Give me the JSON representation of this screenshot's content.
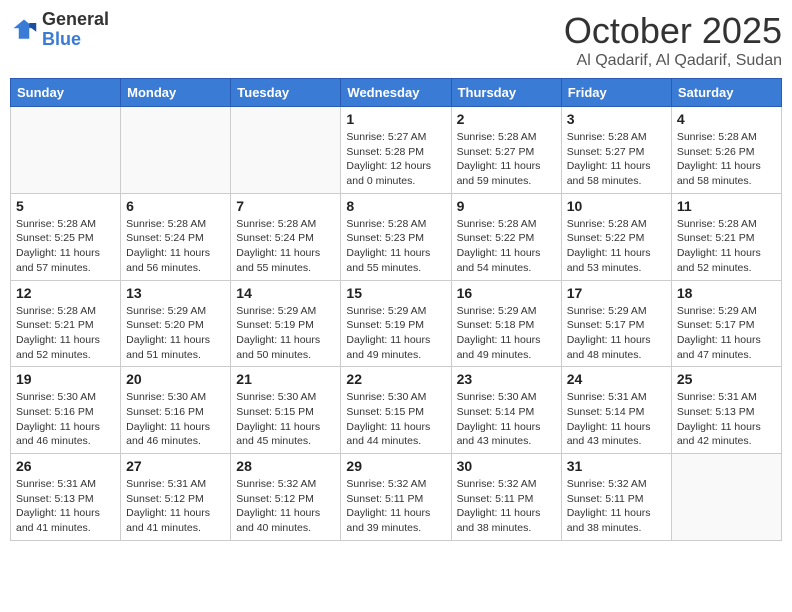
{
  "logo": {
    "general": "General",
    "blue": "Blue"
  },
  "header": {
    "month": "October 2025",
    "location": "Al Qadarif, Al Qadarif, Sudan"
  },
  "weekdays": [
    "Sunday",
    "Monday",
    "Tuesday",
    "Wednesday",
    "Thursday",
    "Friday",
    "Saturday"
  ],
  "weeks": [
    [
      {
        "day": "",
        "info": ""
      },
      {
        "day": "",
        "info": ""
      },
      {
        "day": "",
        "info": ""
      },
      {
        "day": "1",
        "info": "Sunrise: 5:27 AM\nSunset: 5:28 PM\nDaylight: 12 hours\nand 0 minutes."
      },
      {
        "day": "2",
        "info": "Sunrise: 5:28 AM\nSunset: 5:27 PM\nDaylight: 11 hours\nand 59 minutes."
      },
      {
        "day": "3",
        "info": "Sunrise: 5:28 AM\nSunset: 5:27 PM\nDaylight: 11 hours\nand 58 minutes."
      },
      {
        "day": "4",
        "info": "Sunrise: 5:28 AM\nSunset: 5:26 PM\nDaylight: 11 hours\nand 58 minutes."
      }
    ],
    [
      {
        "day": "5",
        "info": "Sunrise: 5:28 AM\nSunset: 5:25 PM\nDaylight: 11 hours\nand 57 minutes."
      },
      {
        "day": "6",
        "info": "Sunrise: 5:28 AM\nSunset: 5:24 PM\nDaylight: 11 hours\nand 56 minutes."
      },
      {
        "day": "7",
        "info": "Sunrise: 5:28 AM\nSunset: 5:24 PM\nDaylight: 11 hours\nand 55 minutes."
      },
      {
        "day": "8",
        "info": "Sunrise: 5:28 AM\nSunset: 5:23 PM\nDaylight: 11 hours\nand 55 minutes."
      },
      {
        "day": "9",
        "info": "Sunrise: 5:28 AM\nSunset: 5:22 PM\nDaylight: 11 hours\nand 54 minutes."
      },
      {
        "day": "10",
        "info": "Sunrise: 5:28 AM\nSunset: 5:22 PM\nDaylight: 11 hours\nand 53 minutes."
      },
      {
        "day": "11",
        "info": "Sunrise: 5:28 AM\nSunset: 5:21 PM\nDaylight: 11 hours\nand 52 minutes."
      }
    ],
    [
      {
        "day": "12",
        "info": "Sunrise: 5:28 AM\nSunset: 5:21 PM\nDaylight: 11 hours\nand 52 minutes."
      },
      {
        "day": "13",
        "info": "Sunrise: 5:29 AM\nSunset: 5:20 PM\nDaylight: 11 hours\nand 51 minutes."
      },
      {
        "day": "14",
        "info": "Sunrise: 5:29 AM\nSunset: 5:19 PM\nDaylight: 11 hours\nand 50 minutes."
      },
      {
        "day": "15",
        "info": "Sunrise: 5:29 AM\nSunset: 5:19 PM\nDaylight: 11 hours\nand 49 minutes."
      },
      {
        "day": "16",
        "info": "Sunrise: 5:29 AM\nSunset: 5:18 PM\nDaylight: 11 hours\nand 49 minutes."
      },
      {
        "day": "17",
        "info": "Sunrise: 5:29 AM\nSunset: 5:17 PM\nDaylight: 11 hours\nand 48 minutes."
      },
      {
        "day": "18",
        "info": "Sunrise: 5:29 AM\nSunset: 5:17 PM\nDaylight: 11 hours\nand 47 minutes."
      }
    ],
    [
      {
        "day": "19",
        "info": "Sunrise: 5:30 AM\nSunset: 5:16 PM\nDaylight: 11 hours\nand 46 minutes."
      },
      {
        "day": "20",
        "info": "Sunrise: 5:30 AM\nSunset: 5:16 PM\nDaylight: 11 hours\nand 46 minutes."
      },
      {
        "day": "21",
        "info": "Sunrise: 5:30 AM\nSunset: 5:15 PM\nDaylight: 11 hours\nand 45 minutes."
      },
      {
        "day": "22",
        "info": "Sunrise: 5:30 AM\nSunset: 5:15 PM\nDaylight: 11 hours\nand 44 minutes."
      },
      {
        "day": "23",
        "info": "Sunrise: 5:30 AM\nSunset: 5:14 PM\nDaylight: 11 hours\nand 43 minutes."
      },
      {
        "day": "24",
        "info": "Sunrise: 5:31 AM\nSunset: 5:14 PM\nDaylight: 11 hours\nand 43 minutes."
      },
      {
        "day": "25",
        "info": "Sunrise: 5:31 AM\nSunset: 5:13 PM\nDaylight: 11 hours\nand 42 minutes."
      }
    ],
    [
      {
        "day": "26",
        "info": "Sunrise: 5:31 AM\nSunset: 5:13 PM\nDaylight: 11 hours\nand 41 minutes."
      },
      {
        "day": "27",
        "info": "Sunrise: 5:31 AM\nSunset: 5:12 PM\nDaylight: 11 hours\nand 41 minutes."
      },
      {
        "day": "28",
        "info": "Sunrise: 5:32 AM\nSunset: 5:12 PM\nDaylight: 11 hours\nand 40 minutes."
      },
      {
        "day": "29",
        "info": "Sunrise: 5:32 AM\nSunset: 5:11 PM\nDaylight: 11 hours\nand 39 minutes."
      },
      {
        "day": "30",
        "info": "Sunrise: 5:32 AM\nSunset: 5:11 PM\nDaylight: 11 hours\nand 38 minutes."
      },
      {
        "day": "31",
        "info": "Sunrise: 5:32 AM\nSunset: 5:11 PM\nDaylight: 11 hours\nand 38 minutes."
      },
      {
        "day": "",
        "info": ""
      }
    ]
  ]
}
